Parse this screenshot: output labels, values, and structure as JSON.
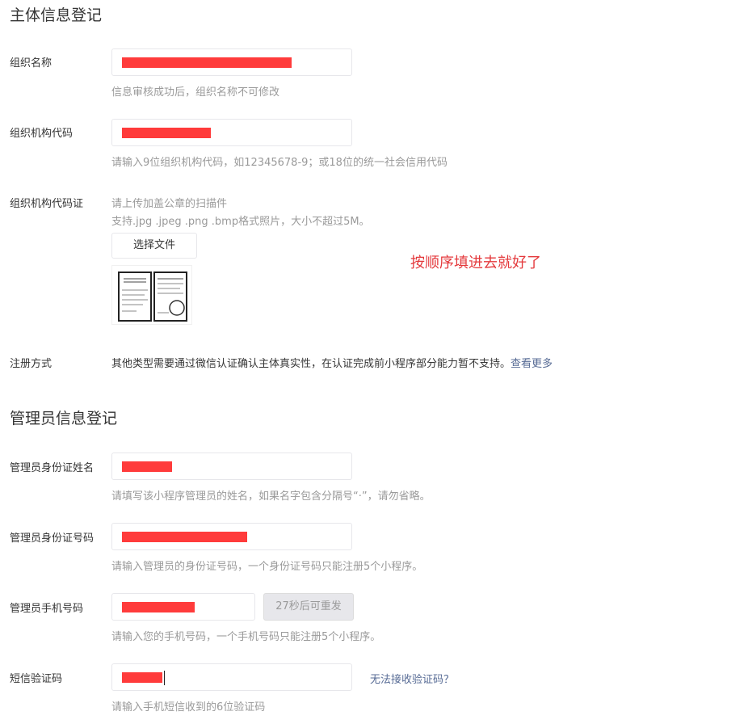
{
  "subject_section": {
    "title": "主体信息登记",
    "org_name": {
      "label": "组织名称",
      "hint": "信息审核成功后，组织名称不可修改"
    },
    "org_code": {
      "label": "组织机构代码",
      "hint": "请输入9位组织机构代码，如12345678-9；或18位的统一社会信用代码"
    },
    "org_cert": {
      "label": "组织机构代码证",
      "hint_line1": "请上传加盖公章的扫描件",
      "hint_line2": "支持.jpg .jpeg .png .bmp格式照片，大小不超过5M。",
      "button_label": "选择文件"
    },
    "register_method": {
      "label": "注册方式",
      "text": "其他类型需要通过微信认证确认主体真实性，在认证完成前小程序部分能力暂不支持。",
      "link": "查看更多"
    }
  },
  "annotation": "按顺序填进去就好了",
  "admin_section": {
    "title": "管理员信息登记",
    "name": {
      "label": "管理员身份证姓名",
      "hint": "请填写该小程序管理员的姓名，如果名字包含分隔号“·”，请勿省略。"
    },
    "id_number": {
      "label": "管理员身份证号码",
      "hint": "请输入管理员的身份证号码，一个身份证号码只能注册5个小程序。"
    },
    "phone": {
      "label": "管理员手机号码",
      "resend_button": "27秒后可重发",
      "hint": "请输入您的手机号码，一个手机号码只能注册5个小程序。"
    },
    "sms_code": {
      "label": "短信验证码",
      "link": "无法接收验证码？",
      "hint": "请输入手机短信收到的6位验证码"
    }
  },
  "colors": {
    "redaction": "#ff3b3b",
    "link": "#576b95",
    "annotation": "#e4393c",
    "hint": "#9a9a9a"
  }
}
